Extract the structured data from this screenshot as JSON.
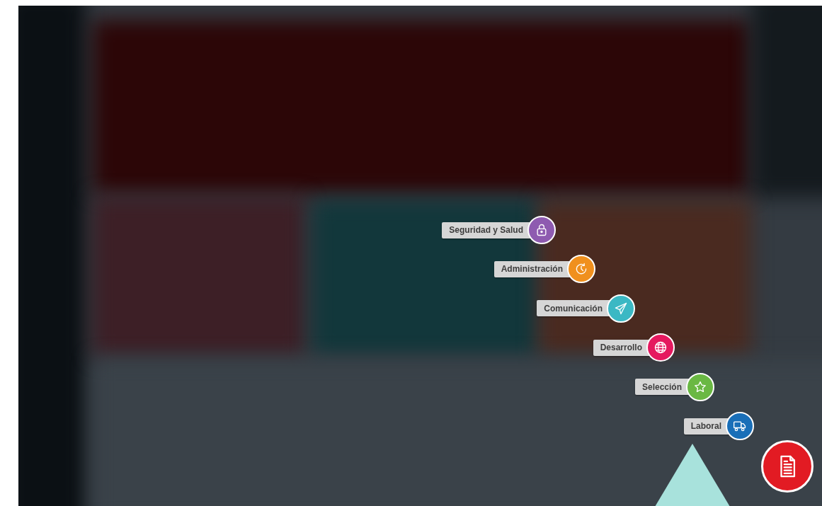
{
  "menu": {
    "items": [
      {
        "label": "Seguridad y Salud",
        "kind": "lock",
        "color": "#8e5bb0"
      },
      {
        "label": "Administración",
        "kind": "clock",
        "color": "#f0901e"
      },
      {
        "label": "Comunicación",
        "kind": "plane",
        "color": "#3bb8c4"
      },
      {
        "label": "Desarrollo",
        "kind": "globe",
        "color": "#e5195f"
      },
      {
        "label": "Selección",
        "kind": "star",
        "color": "#6ab843"
      },
      {
        "label": "Laboral",
        "kind": "truck",
        "color": "#1a6fb8"
      }
    ]
  },
  "fab": {
    "kind": "document",
    "color": "#e21b23"
  }
}
